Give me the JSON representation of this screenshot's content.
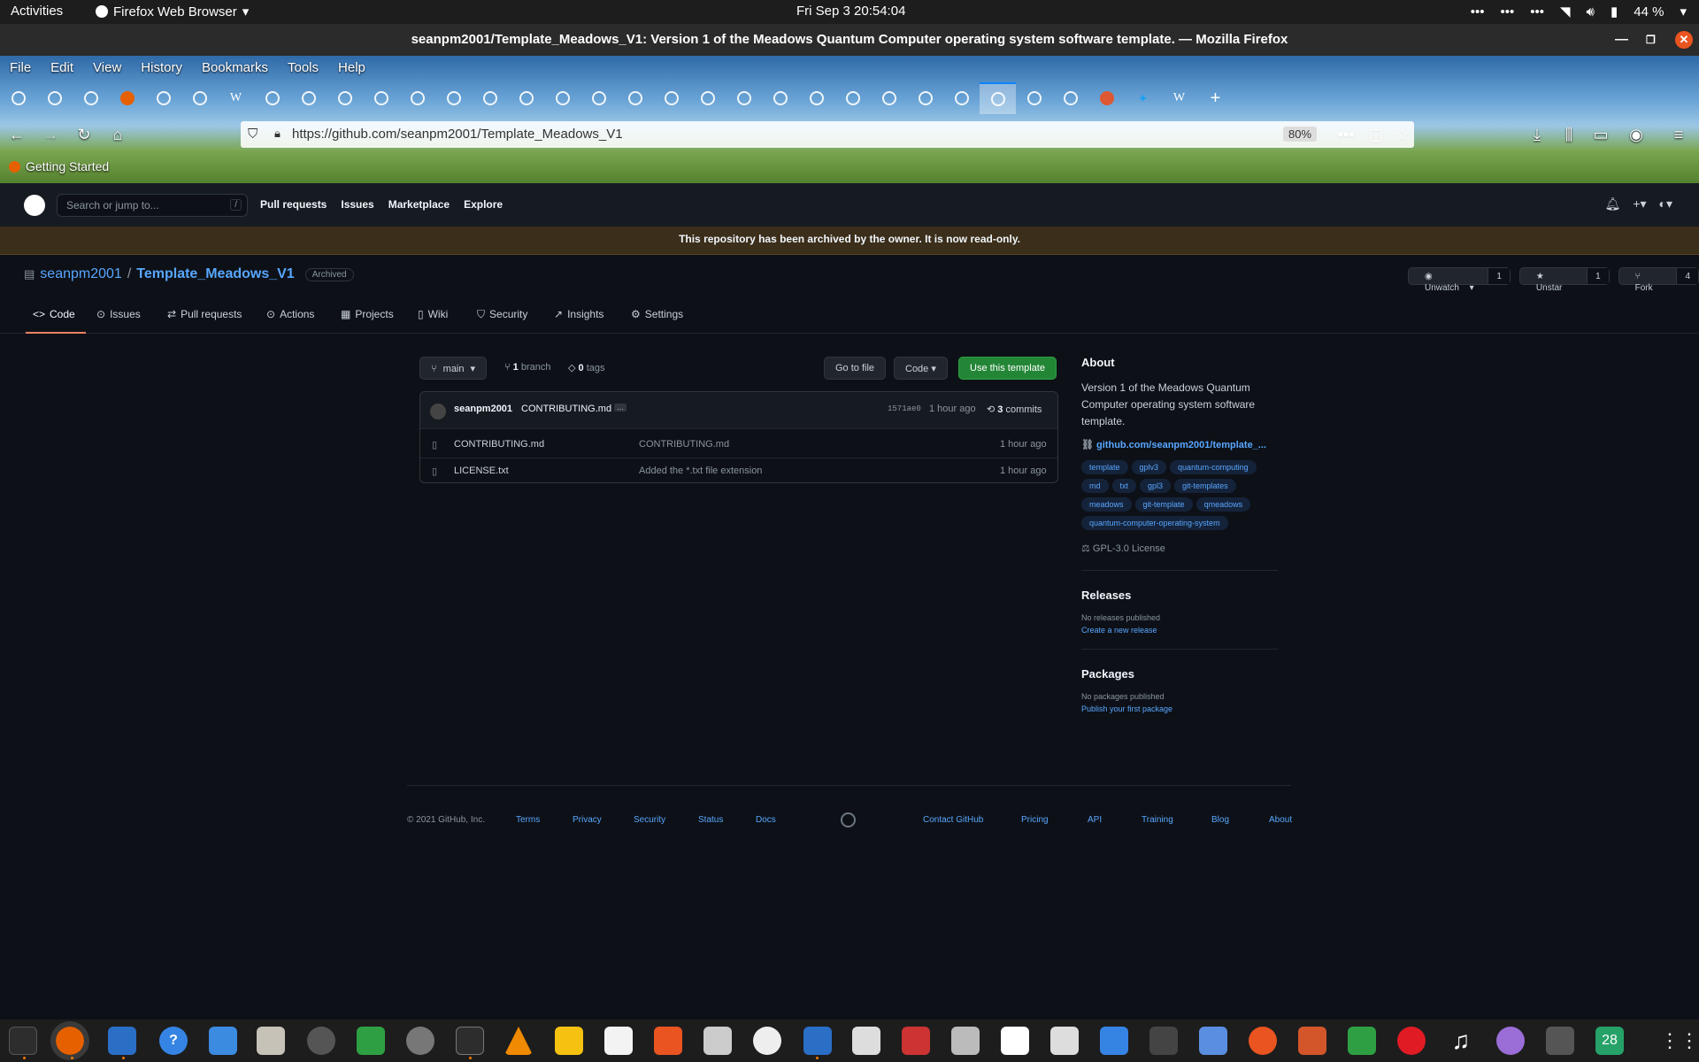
{
  "system": {
    "activities": "Activities",
    "app_name": "Firefox Web Browser",
    "clock": "Fri Sep 3  20:54:04",
    "battery": "44 %"
  },
  "window": {
    "title": "seanpm2001/Template_Meadows_V1: Version 1 of the Meadows Quantum Computer operating system software template. — Mozilla Firefox"
  },
  "menubar": [
    "File",
    "Edit",
    "View",
    "History",
    "Bookmarks",
    "Tools",
    "Help"
  ],
  "browser": {
    "url_host": "https://github.com",
    "url_path": "/seanpm2001/Template_Meadows_V1",
    "zoom": "80%",
    "bookmark": "Getting Started"
  },
  "github": {
    "search_placeholder": "Search or jump to...",
    "search_key": "/",
    "nav": [
      "Pull requests",
      "Issues",
      "Marketplace",
      "Explore"
    ],
    "archive_notice": "This repository has been archived by the owner. It is now read-only.",
    "owner": "seanpm2001",
    "separator": "/",
    "repo": "Template_Meadows_V1",
    "archived_badge": "Archived",
    "watch_label": "Unwatch",
    "watch_count": "1",
    "star_label": "Unstar",
    "star_count": "1",
    "fork_label": "Fork",
    "fork_count": "4",
    "tabs": [
      "Code",
      "Issues",
      "Pull requests",
      "Actions",
      "Projects",
      "Wiki",
      "Security",
      "Insights",
      "Settings"
    ],
    "branch_button": "main",
    "branch_count": "1",
    "branch_word": "branch",
    "tag_count": "0",
    "tag_word": "tags",
    "go_to_file": "Go to file",
    "code_button": "Code",
    "template_button": "Use this template",
    "commit": {
      "author": "seanpm2001",
      "message": "CONTRIBUTING.md",
      "ellipsis": "…",
      "sha": "1571ae0",
      "time": "1 hour ago",
      "count": "3",
      "count_word": "commits"
    },
    "files": [
      {
        "name": "CONTRIBUTING.md",
        "message": "CONTRIBUTING.md",
        "time": "1 hour ago"
      },
      {
        "name": "LICENSE.txt",
        "message": "Added the *.txt file extension",
        "time": "1 hour ago"
      }
    ],
    "about": {
      "heading": "About",
      "description": "Version 1 of the Meadows Quantum Computer operating system software template.",
      "link": "github.com/seanpm2001/template_...",
      "topics": [
        "template",
        "gplv3",
        "quantum-computing",
        "md",
        "txt",
        "gpl3",
        "git-templates",
        "meadows",
        "git-template",
        "qmeadows",
        "quantum-computer-operating-system"
      ],
      "license": "GPL-3.0 License"
    },
    "releases": {
      "heading": "Releases",
      "none": "No releases published",
      "create": "Create a new release"
    },
    "packages": {
      "heading": "Packages",
      "none": "No packages published",
      "publish": "Publish your first package"
    },
    "footer": {
      "copyright": "© 2021 GitHub, Inc.",
      "left_links": [
        "Terms",
        "Privacy",
        "Security",
        "Status",
        "Docs"
      ],
      "right_links": [
        "Contact GitHub",
        "Pricing",
        "API",
        "Training",
        "Blog",
        "About"
      ]
    }
  },
  "dock": {
    "calendar_day": "28"
  },
  "colors": {
    "accent": "#58a6ff",
    "green": "#238636",
    "tab_underline": "#f78166"
  }
}
